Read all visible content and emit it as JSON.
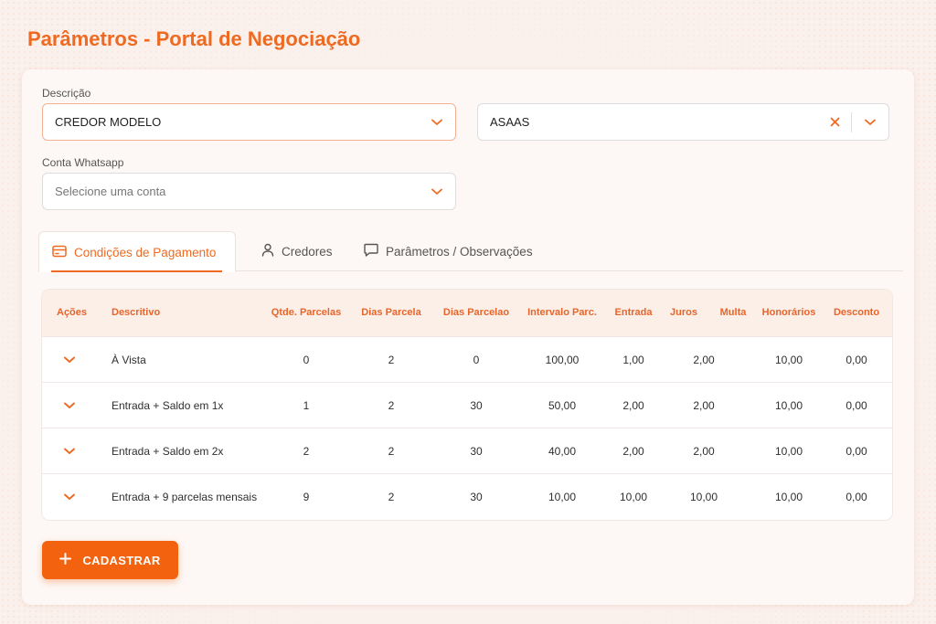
{
  "page": {
    "title": "Parâmetros - Portal de Negociação"
  },
  "form": {
    "descricao_label": "Descrição",
    "descricao_value": "CREDOR MODELO",
    "provider_value": "ASAAS",
    "whatsapp_label": "Conta Whatsapp",
    "whatsapp_placeholder": "Selecione uma conta"
  },
  "tabs": [
    {
      "label": "Condições de Pagamento",
      "icon": "card-icon",
      "active": true
    },
    {
      "label": "Credores",
      "icon": "user-icon",
      "active": false
    },
    {
      "label": "Parâmetros / Observações",
      "icon": "chat-icon",
      "active": false
    }
  ],
  "table": {
    "headers": [
      "Ações",
      "Descritivo",
      "Qtde. Parcelas",
      "Dias Parcela",
      "Dias Parcelao",
      "Intervalo Parc.",
      "Entrada",
      "Juros",
      "Multa",
      "Honorários",
      "Desconto"
    ],
    "rows": [
      {
        "descritivo": "À Vista",
        "qtde": "0",
        "dias_parcela": "2",
        "dias_parcelao": "0",
        "intervalo": "100,00",
        "entrada": "1,00",
        "juros": "2,00",
        "honorarios": "10,00",
        "desconto": "0,00"
      },
      {
        "descritivo": "Entrada + Saldo em 1x",
        "qtde": "1",
        "dias_parcela": "2",
        "dias_parcelao": "30",
        "intervalo": "50,00",
        "entrada": "2,00",
        "juros": "2,00",
        "honorarios": "10,00",
        "desconto": "0,00"
      },
      {
        "descritivo": "Entrada + Saldo em 2x",
        "qtde": "2",
        "dias_parcela": "2",
        "dias_parcelao": "30",
        "intervalo": "40,00",
        "entrada": "2,00",
        "juros": "2,00",
        "honorarios": "10,00",
        "desconto": "0,00"
      },
      {
        "descritivo": "Entrada + 9 parcelas mensais",
        "qtde": "9",
        "dias_parcela": "2",
        "dias_parcelao": "30",
        "intervalo": "10,00",
        "entrada": "10,00",
        "juros": "10,00",
        "honorarios": "10,00",
        "desconto": "0,00"
      }
    ]
  },
  "actions": {
    "cadastrar_label": "CADASTRAR"
  },
  "colors": {
    "accent": "#ee6a22",
    "button": "#f2620f",
    "background": "#fbf1ec"
  }
}
